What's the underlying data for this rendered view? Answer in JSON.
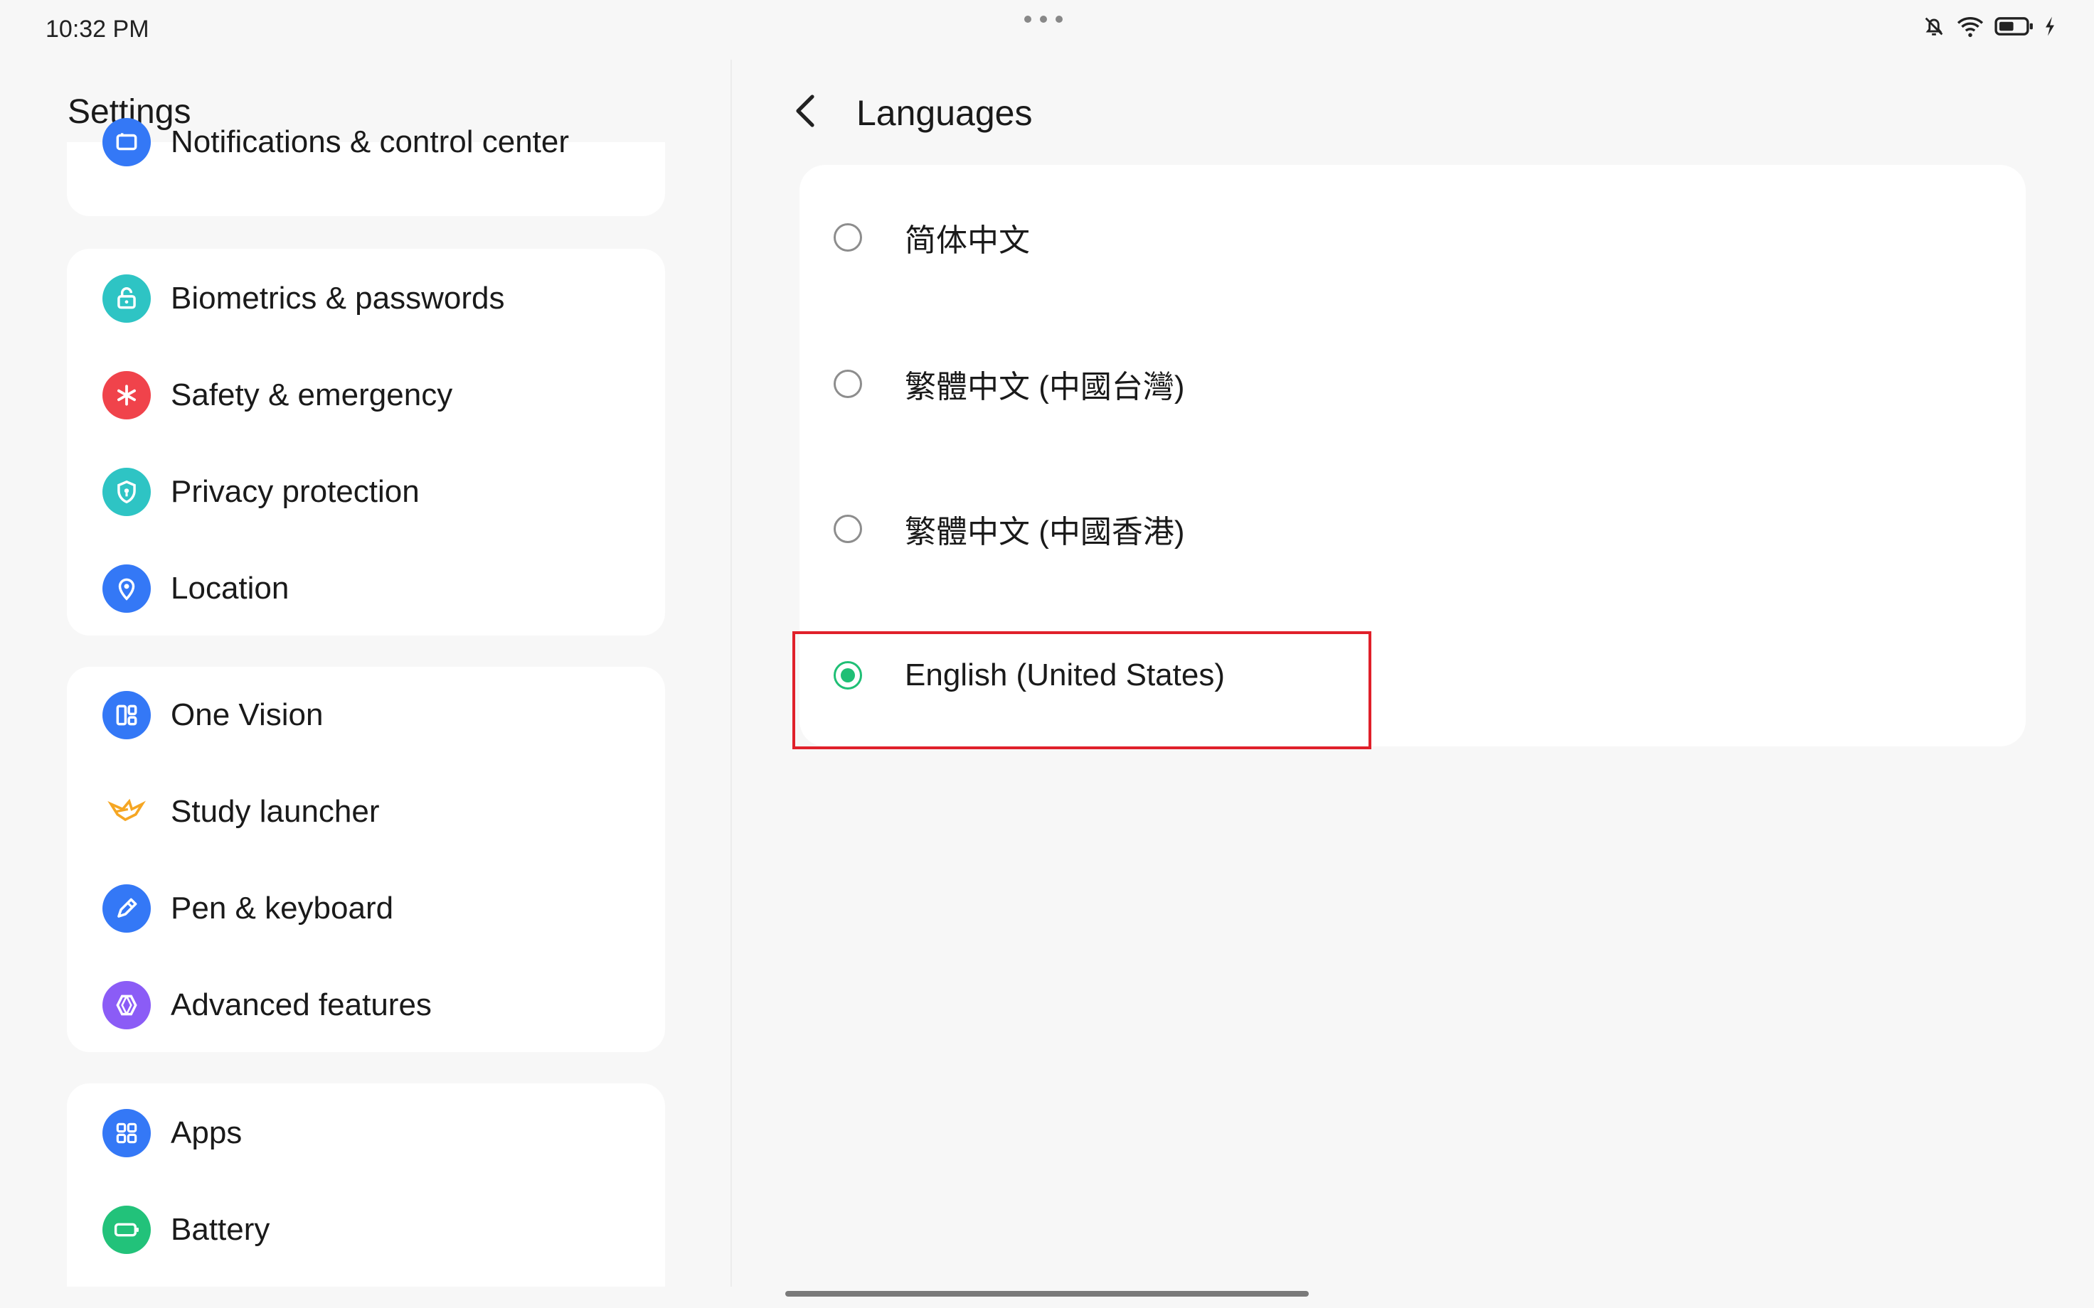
{
  "status_bar": {
    "time": "10:32 PM",
    "icons": [
      "mute-bell-icon",
      "wifi-icon",
      "battery-icon",
      "charging-icon"
    ]
  },
  "sidebar": {
    "title": "Settings",
    "items": [
      {
        "label": "Notifications & control center",
        "icon": "notifications-icon",
        "color": "#3478f6"
      },
      {
        "label": "Biometrics & passwords",
        "icon": "lock-icon",
        "color": "#2ec4c4"
      },
      {
        "label": "Safety & emergency",
        "icon": "asterisk-icon",
        "color": "#f0434b"
      },
      {
        "label": "Privacy protection",
        "icon": "shield-icon",
        "color": "#2ec4c4"
      },
      {
        "label": "Location",
        "icon": "location-pin-icon",
        "color": "#3478f6"
      },
      {
        "label": "One Vision",
        "icon": "layout-icon",
        "color": "#3478f6"
      },
      {
        "label": "Study launcher",
        "icon": "bird-icon",
        "color": "#f5a623"
      },
      {
        "label": "Pen & keyboard",
        "icon": "pen-icon",
        "color": "#3478f6"
      },
      {
        "label": "Advanced features",
        "icon": "hexagon-icon",
        "color": "#8b5cf6"
      },
      {
        "label": "Apps",
        "icon": "apps-grid-icon",
        "color": "#3478f6"
      },
      {
        "label": "Battery",
        "icon": "battery-icon",
        "color": "#22c27a"
      }
    ]
  },
  "languages": {
    "title": "Languages",
    "options": [
      {
        "label": "简体中文",
        "selected": false
      },
      {
        "label": "繁體中文 (中國台灣)",
        "selected": false
      },
      {
        "label": "繁體中文 (中國香港)",
        "selected": false
      },
      {
        "label": "English (United States)",
        "selected": true
      }
    ],
    "accent_color": "#1fbf75"
  }
}
